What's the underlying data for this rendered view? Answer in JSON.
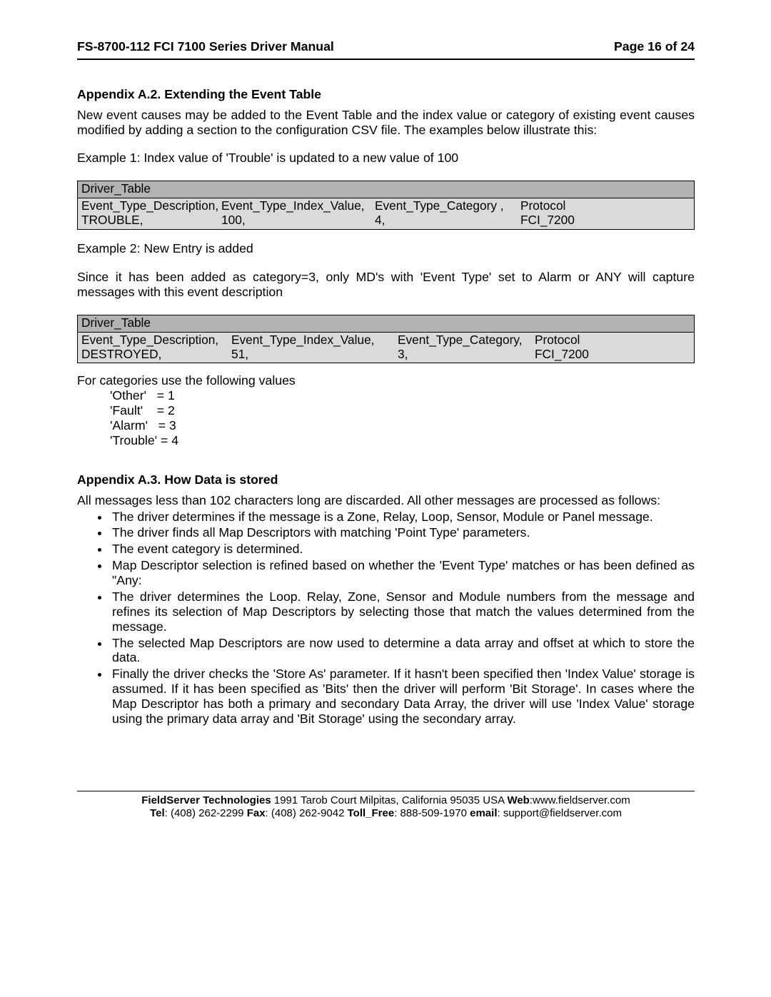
{
  "header": {
    "title": "FS-8700-112 FCI 7100 Series Driver Manual",
    "page_indicator": "Page 16 of 24"
  },
  "section_a2": {
    "heading": "Appendix A.2.   Extending the Event Table",
    "intro": "New event causes may be added to the Event Table and the index value or category of existing event causes modified by adding a section to the configuration CSV file.  The examples below illustrate this:",
    "example1_caption": "Example 1:   Index value of 'Trouble' is updated to a new value of 100",
    "table1": {
      "title": "Driver_Table",
      "col1": "Event_Type_Description,",
      "col2": "Event_Type_Index_Value,",
      "col3": "Event_Type_Category ,",
      "col4": "Protocol",
      "d1": "TROUBLE,",
      "d2": "100,",
      "d3": "4,",
      "d4": "FCI_7200"
    },
    "example2_caption": "Example 2:   New Entry is added",
    "example2_body": "Since it has been added as category=3, only MD's with 'Event Type' set to Alarm or ANY will capture messages with this event description",
    "table2": {
      "title": "Driver_Table",
      "col1": "Event_Type_Description,",
      "col2": "Event_Type_Index_Value,",
      "col3": "Event_Type_Category,",
      "col4": "Protocol",
      "d1": "DESTROYED,",
      "d2": "51,",
      "d3": "3,",
      "d4": "FCI_7200"
    },
    "categories_intro": "For categories use the following values",
    "cat1": "'Other'   = 1",
    "cat2": "'Fault'    = 2",
    "cat3": "'Alarm'   = 3",
    "cat4": "'Trouble' = 4"
  },
  "section_a3": {
    "heading": "Appendix A.3.   How Data is stored",
    "intro": "All messages less than 102 characters long are discarded.  All other messages are processed as follows:",
    "bullets": [
      "The driver determines if the message is a Zone, Relay, Loop, Sensor, Module or Panel message.",
      "The driver finds all Map Descriptors with matching 'Point Type' parameters.",
      "The event category is determined.",
      "Map Descriptor selection is refined based on whether the 'Event Type' matches or has been defined as \"Any:",
      "The driver determines the Loop. Relay, Zone, Sensor and Module numbers from the message and refines its selection of Map Descriptors by selecting those that match the values determined from the message.",
      "The selected Map Descriptors are now used to determine a data array and offset at which to store the data.",
      "Finally the driver checks the 'Store As' parameter. If it hasn't been specified then 'Index Value' storage is assumed.  If it has been specified as 'Bits' then the driver will perform 'Bit Storage'.  In cases where the Map Descriptor has both a primary and secondary Data Array, the driver will use 'Index Value' storage using the primary data array and 'Bit Storage' using the secondary array."
    ]
  },
  "footer": {
    "company_bold": "FieldServer Technologies",
    "addr": " 1991 Tarob Court Milpitas, California 95035 USA  ",
    "web_label": "Web",
    "web_colon": ":www.fieldserver.com",
    "tel_label": "Tel",
    "tel_val": ": (408) 262-2299   ",
    "fax_label": "Fax",
    "fax_val": ": (408) 262-9042   ",
    "tollfree_label": "Toll_Free",
    "tollfree_val": ": 888-509-1970   ",
    "email_label": "email",
    "email_val": ": support@fieldserver.com"
  }
}
